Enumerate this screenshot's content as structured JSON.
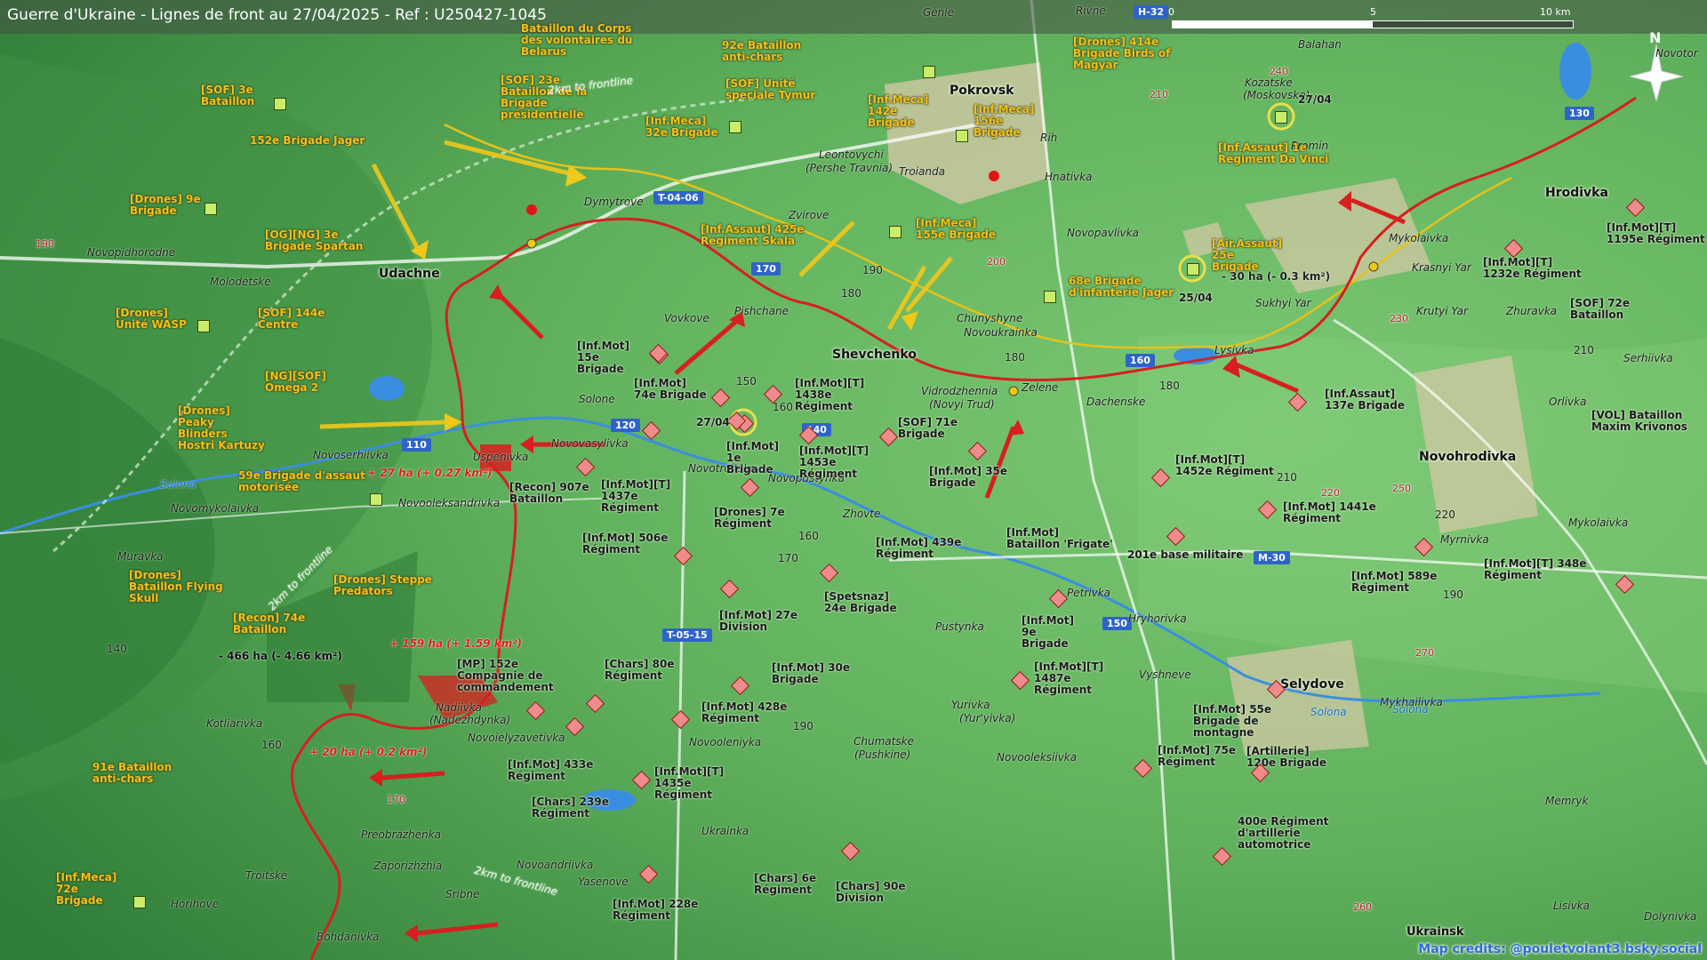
{
  "title": "Guerre d'Ukraine - Lignes de front au 27/04/2025 - Ref : U250427-1045",
  "scale": {
    "ticks": [
      "0",
      "5",
      "10 km"
    ]
  },
  "compass": {
    "north_label": "N"
  },
  "credits": "Map credits: @pouletvolant3.bsky.social",
  "colors": {
    "front_line": "#d71f1f",
    "old_front": "#e6c21a",
    "terrain": "#6fb86a",
    "water": "#3a8ee0"
  },
  "cities": [
    "Pokrovsk",
    "Udachne",
    "Shevchenko",
    "Novohrodivka",
    "Selydove",
    "Hrodivka",
    "Ukrainsk"
  ],
  "towns": [
    "Rivne",
    "Génie",
    "Balahan",
    "Kozatske",
    "(Moskovske)",
    "Promin",
    "Rih",
    "Hnativka",
    "Leontovychi",
    "(Pershe Travnia)",
    "Troianda",
    "Dymytrove",
    "Zvirove",
    "Novopavlivka",
    "Mykolaivka",
    "Krasnyi Yar",
    "Krutyi Yar",
    "Zhuravka",
    "Serhiivka",
    "Novopidhorodne",
    "Molodetske",
    "Vovkove",
    "Pishchane",
    "Chunyshyne",
    "Novoukrainka",
    "Sukhyi Yar",
    "Lysivka",
    "Solone",
    "Vidrodzhennia",
    "(Novyi Trud)",
    "Zelene",
    "Dachenske",
    "Orlivka",
    "Novoserhiivka",
    "Uspenivka",
    "Novovasylivka",
    "Novotroitske",
    "Novopustynka",
    "Novomykolaivka",
    "Novooleksandrivka",
    "Zhovte",
    "Myrnivka",
    "Mykolaivka",
    "Muravka",
    "Petrivka",
    "Hryhorivka",
    "Pustynka",
    "Vyshneve",
    "Mykhailivka",
    "Nadiivka",
    "(Nadezhdynka)",
    "Kotliarivka",
    "Novoielyzavetivka",
    "Novooleniyka",
    "Chumatske",
    "(Pushkine)",
    "Yurivka",
    "(Yur'yivka)",
    "Novooleksiivka",
    "Memryk",
    "Ukrainka",
    "Preobrazhenka",
    "Zaporizhzhia",
    "Novoandriivka",
    "Troitske",
    "Yasenove",
    "Sribne",
    "Horihove",
    "Bohdanivka",
    "Lisivka",
    "Dolynivka",
    "Novotor"
  ],
  "ukr_units": [
    "Bataillon du Corps des volontaires du Belarus",
    "[SOF] 3e Bataillon",
    "[SOF] 23e Bataillon de la Brigade présidentielle",
    "92e Bataillon anti-chars",
    "[SOF] Unité spéciale Tymur",
    "[Drones] 414e Brigade Birds of Magyar",
    "152e Brigade Jager",
    "[Inf.Meca] 32e Brigade",
    "[Inf.Meca] 142e Brigade",
    "[Inf.Meca] 156e Brigade",
    "[Inf.Assaut] 1e Régiment Da Vinci",
    "[Drones] 9e Brigade",
    "[OG][NG] 3e Brigade Spartan",
    "[Inf.Assaut] 425e Régiment Skala",
    "[Inf.Meca] 155e Brigade",
    "[Air.Assaut] 25e Brigade",
    "68e Brigade d'infanterie Jager",
    "[Drones] Unité WASP",
    "[SOF] 144e Centre",
    "[NG][SOF] Omega 2",
    "[Drones] Peaky Blinders Hostri Kartuzy",
    "59e Brigade d'assaut motorisée",
    "[Drones] Steppe Predators",
    "[Drones] Bataillon Flying Skull",
    "[Recon] 74e Bataillon",
    "91e Bataillon anti-chars",
    "[Inf.Meca] 72e Brigade"
  ],
  "rus_units": [
    "[Inf.Mot] 15e Brigade",
    "[Inf.Mot] 74e Brigade",
    "[Inf.Mot][T] 1438e Régiment",
    "[Inf.Mot] 1e Brigade",
    "[SOF] 71e Brigade",
    "[Inf.Mot][T] 1453e Régiment",
    "[Recon] 907e Bataillon",
    "[Inf.Mot][T] 1437e Régiment",
    "[Drones] 7e Régiment",
    "[Inf.Mot] 35e Brigade",
    "[Inf.Mot] Bataillon 'Frigate'",
    "[Inf.Mot] 506e Régiment",
    "[Inf.Mot] 439e Régiment",
    "[Spetsnaz] 24e Brigade",
    "[Inf.Mot] 27e Division",
    "[Inf.Mot][T] 1452e Régiment",
    "[Inf.Mot] 1441e Régiment",
    "201e base militaire",
    "[Inf.Mot] 589e Régiment",
    "[Inf.Mot][T] 348e Régiment",
    "[Inf.Mot] 9e Brigade",
    "[Inf.Mot][T] 1487e Régiment",
    "[Inf.Mot] 55e Brigade de montagne",
    "[Inf.Mot] 75e Régiment",
    "[Artillerie] 120e Brigade",
    "400e Régiment d'artillerie automotrice",
    "[MP] 152e Compagnie de commandement",
    "[Chars] 80e Régiment",
    "[Inf.Mot] 30e Brigade",
    "[Inf.Mot] 428e Régiment",
    "[Inf.Mot] 433e Régiment",
    "[Inf.Mot][T] 1435e Régiment",
    "[Chars] 239e Régiment",
    "[Chars] 6e Régiment",
    "[Chars] 90e Division",
    "[Inf.Mot] 228e Régiment",
    "[Inf.Assaut] 137e Brigade",
    "[Inf.Mot][T] 1195e Régiment",
    "[Inf.Mot][T] 1232e Régiment",
    "[SOF] 72e Bataillon",
    "[VOL] Bataillon Maxim Krivonos"
  ],
  "area_changes": [
    "- 30 ha (- 0.3 km²)",
    "+ 27 ha (+ 0.27 km²)",
    "+ 159 ha (+ 1.59 km²)",
    "- 466 ha (- 4.66 km²)",
    "+ 20 ha (+ 0.2 km²)"
  ],
  "dates": [
    "27/04",
    "25/04",
    "27/04"
  ],
  "frontline_notes": [
    "2km to frontline",
    "2km to frontline",
    "2km to frontline"
  ],
  "roads": [
    "T-04-06",
    "T-05-15",
    "M-30",
    "H-32",
    "110",
    "120",
    "140",
    "150",
    "160",
    "170",
    "130"
  ],
  "road_numbers_red": [
    "240",
    "210",
    "190",
    "200",
    "230",
    "220",
    "250",
    "270",
    "260",
    "170"
  ],
  "contours": [
    "180",
    "190",
    "180",
    "150",
    "160",
    "170",
    "160",
    "140",
    "160",
    "190",
    "180",
    "210",
    "220",
    "210",
    "190"
  ],
  "rivers": [
    "Solona",
    "Solona",
    "Solona"
  ]
}
